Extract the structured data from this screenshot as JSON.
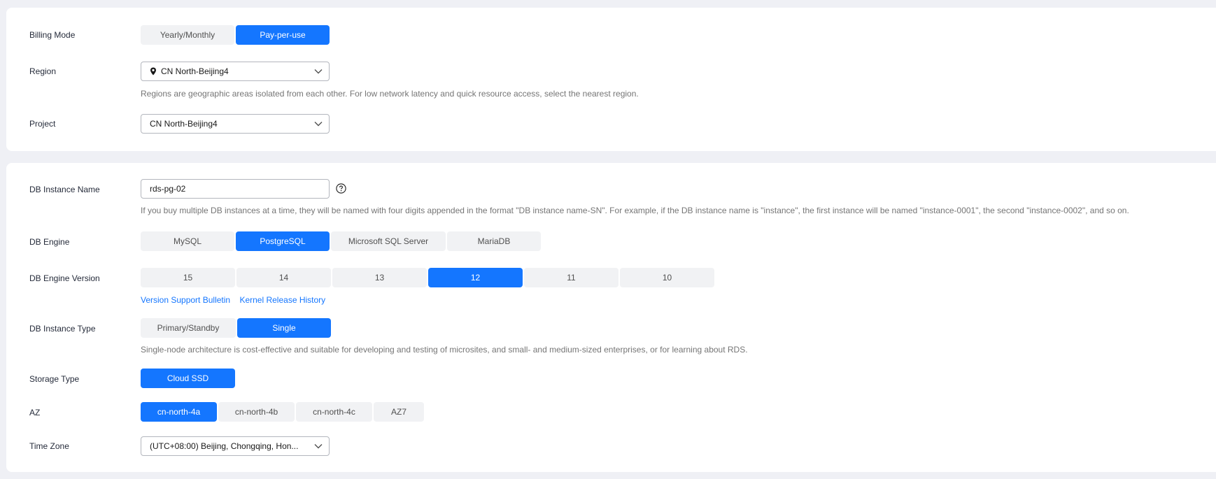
{
  "billing": {
    "label": "Billing Mode",
    "options": [
      "Yearly/Monthly",
      "Pay-per-use"
    ],
    "selected": "Pay-per-use"
  },
  "region": {
    "label": "Region",
    "value": "CN North-Beijing4",
    "hint": "Regions are geographic areas isolated from each other. For low network latency and quick resource access, select the nearest region."
  },
  "project": {
    "label": "Project",
    "value": "CN North-Beijing4"
  },
  "instance_name": {
    "label": "DB Instance Name",
    "value": "rds-pg-02",
    "hint": "If you buy multiple DB instances at a time, they will be named with four digits appended in the format \"DB instance name-SN\". For example, if the DB instance name is \"instance\", the first instance will be named \"instance-0001\", the second \"instance-0002\", and so on."
  },
  "engine": {
    "label": "DB Engine",
    "options": [
      "MySQL",
      "PostgreSQL",
      "Microsoft SQL Server",
      "MariaDB"
    ],
    "selected": "PostgreSQL"
  },
  "engine_version": {
    "label": "DB Engine Version",
    "options": [
      "15",
      "14",
      "13",
      "12",
      "11",
      "10"
    ],
    "selected": "12",
    "links": [
      "Version Support Bulletin",
      "Kernel Release History"
    ]
  },
  "instance_type": {
    "label": "DB Instance Type",
    "options": [
      "Primary/Standby",
      "Single"
    ],
    "selected": "Single",
    "hint": "Single-node architecture is cost-effective and suitable for developing and testing of microsites, and small- and medium-sized enterprises, or for learning about RDS."
  },
  "storage_type": {
    "label": "Storage Type",
    "options": [
      "Cloud SSD"
    ],
    "selected": "Cloud SSD"
  },
  "az": {
    "label": "AZ",
    "options": [
      "cn-north-4a",
      "cn-north-4b",
      "cn-north-4c",
      "AZ7"
    ],
    "selected": "cn-north-4a"
  },
  "time_zone": {
    "label": "Time Zone",
    "value": "(UTC+08:00) Beijing, Chongqing, Hon..."
  },
  "colors": {
    "accent": "#1476ff",
    "option_bg": "#f1f2f4",
    "page_bg": "#eff0f5"
  }
}
